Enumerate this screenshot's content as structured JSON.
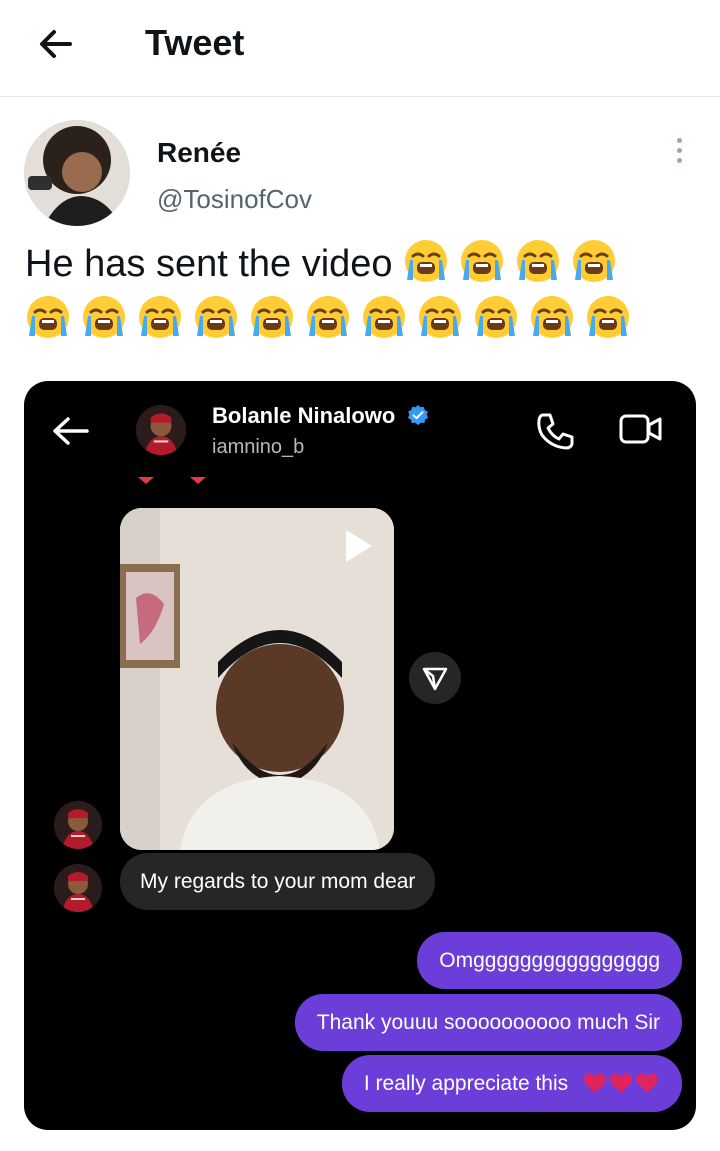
{
  "header": {
    "title": "Tweet"
  },
  "tweet": {
    "author_name": "Renée",
    "author_handle": "@TosinofCov",
    "text": "He has sent the video",
    "emoji": "loudly-crying-face",
    "emoji_count": 15
  },
  "dm": {
    "contact_name": "Bolanle Ninalowo",
    "contact_handle": "iamnino_b",
    "messages": [
      {
        "direction": "incoming",
        "type": "video"
      },
      {
        "direction": "incoming",
        "type": "text",
        "text": "My regards to your mom dear"
      },
      {
        "direction": "outgoing",
        "type": "text",
        "text": "Omgggggggggggggggg"
      },
      {
        "direction": "outgoing",
        "type": "text",
        "text": "Thank youuu soooooooooo much Sir"
      },
      {
        "direction": "outgoing",
        "type": "text",
        "text": "I really appreciate this",
        "emoji": "red-hearts",
        "emoji_count": 3
      }
    ]
  },
  "colors": {
    "outgoing_bubble": "#6c3ed9",
    "incoming_bubble": "#262626",
    "verified_badge": "#3897f0",
    "heart": "#e0245e"
  },
  "icons": [
    "back-arrow-icon",
    "more-options-icon",
    "back-arrow-icon",
    "phone-icon",
    "video-call-icon",
    "play-icon",
    "share-icon",
    "verified-badge-icon"
  ]
}
